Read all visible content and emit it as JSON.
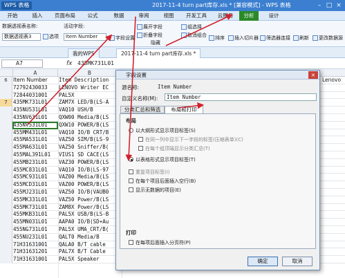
{
  "titlebar": {
    "app_name": "WPS 表格",
    "title": "2017-11-4 turn part库存.xls * [兼容模式] - WPS 表格",
    "min": "–",
    "max": "□",
    "close": "×"
  },
  "ribbon_tabs": [
    "开始",
    "插入",
    "页面布局",
    "公式",
    "数据",
    "审阅",
    "视图",
    "开发工具",
    "云服务",
    "分析",
    "设计"
  ],
  "ribbon": {
    "pivot_name_label": "数据透视表名称:",
    "pivot_name_value": "数据透视表3",
    "options_label": "选项",
    "active_field_label": "活动字段:",
    "active_field_value": "Item Number",
    "field_settings_label": "字段设置",
    "expand_label": "展开字段",
    "collapse_label": "折叠字段",
    "hide_label": "隐藏",
    "group_label": "组选择",
    "ungroup_label": "取消组合",
    "sort_label": "排序",
    "slicer_label": "插入切片器",
    "filter_conn_label": "筛选器连接",
    "refresh_label": "刷新",
    "change_source_label": "更改数据源"
  },
  "doc_tabs": [
    "我的WPS",
    "2017-11-4 turn part库存.xls *"
  ],
  "formula_bar": {
    "cell_ref": "A7",
    "fx": "fx",
    "value": "435MK731L01"
  },
  "columns": [
    "A",
    "B"
  ],
  "rows": [
    {
      "n": "6",
      "a": "Item Number",
      "b": "Item Description",
      "r": "Lenovo"
    },
    {
      "n": "",
      "a": "72792430033",
      "b": "LENOVO Writer EC",
      "r": ""
    },
    {
      "n": "",
      "a": "72844031001",
      "b": "PAL5X",
      "r": ""
    },
    {
      "n": "7",
      "a": "435MK731L01",
      "b": "ZAM7X LED/B(LS-A",
      "r": ""
    },
    {
      "n": "",
      "a": "435NU531L01",
      "b": "VAQ10 USH/B",
      "r": ""
    },
    {
      "n": "",
      "a": "435NV631L01",
      "b": "QXW00 Media/B(LS",
      "r": ""
    },
    {
      "n": "",
      "a": "435NV531L01",
      "b": "QXW10 POWER/B(LS",
      "r": ""
    },
    {
      "n": "",
      "a": "455MM431L01",
      "b": "VAQ10 IO/B CRT/B",
      "r": ""
    },
    {
      "n": "",
      "a": "455MA531L01",
      "b": "VAZ50 SIM/B(LS-9",
      "r": ""
    },
    {
      "n": "",
      "a": "455MA631L01",
      "b": "VAZ50 Sniffer/B(",
      "r": ""
    },
    {
      "n": "",
      "a": "455MAL391L01",
      "b": "VIUS1 SD CACE(LS",
      "r": ""
    },
    {
      "n": "",
      "a": "455MB231L01",
      "b": "VAZ30 POWER/B(LS",
      "r": ""
    },
    {
      "n": "",
      "a": "455MC831L01",
      "b": "VAQ10 IO/B(LS-97",
      "r": ""
    },
    {
      "n": "",
      "a": "455MC931L01",
      "b": "VAZ00 Media/B(LS",
      "r": ""
    },
    {
      "n": "",
      "a": "455MCD31L01",
      "b": "VAZ00 POWER/B(LS",
      "r": ""
    },
    {
      "n": "",
      "a": "455MJ231L01",
      "b": "VAZ50 IO/B(VAUB0",
      "r": ""
    },
    {
      "n": "",
      "a": "455MK331L01",
      "b": "VAZ50 Power/B(LS",
      "r": ""
    },
    {
      "n": "",
      "a": "455MK731L01",
      "b": "ZAM8X Power/B(LS",
      "r": ""
    },
    {
      "n": "",
      "a": "455MKB31L01",
      "b": "PAL5X USB/B(LS-B",
      "r": ""
    },
    {
      "n": "",
      "a": "455MN031L01",
      "b": "AAPA0 IO/B(SD+Au",
      "r": ""
    },
    {
      "n": "",
      "a": "455NG731L01",
      "b": "PAL5X UMA_CRT/B(",
      "r": ""
    },
    {
      "n": "",
      "a": "455NU231L01",
      "b": "QALT0 Media/B",
      "r": ""
    },
    {
      "n": "",
      "a": "71H31631001",
      "b": "QALA0 B/T cable",
      "r": ""
    },
    {
      "n": "",
      "a": "71H31631201",
      "b": "PAL7X B/T Cable",
      "r": ""
    },
    {
      "n": "",
      "a": "71H31631001",
      "b": "PAL5X Speaker",
      "r": ""
    }
  ],
  "dialog": {
    "title": "字段设置",
    "close": "×",
    "source_label": "源名称:",
    "source_value": "Item Number",
    "custom_label": "自定义名称(M):",
    "custom_value": "Item Number",
    "tabs": [
      "分类汇总和筛选",
      "布局和打印"
    ],
    "layout_group": "布局",
    "opt_outline": "以大纲形式显示项目标签(S)",
    "opt_outline_sub1": "在同一列中显示下一字段的标签(压缩表单)(C)",
    "opt_outline_sub2": "在每个组顶端显示分类汇总(T)",
    "opt_table": "以表格形式显示项目标签(T)",
    "opt_repeat": "重复项目标签(I)",
    "opt_blank_line": "在每个项目后面插入空行(B)",
    "opt_no_data": "显示无数据的项目(E)",
    "print_group": "打印",
    "opt_page_break": "在每项后面插入分页符(P)",
    "ok": "确定",
    "cancel": "取消"
  }
}
